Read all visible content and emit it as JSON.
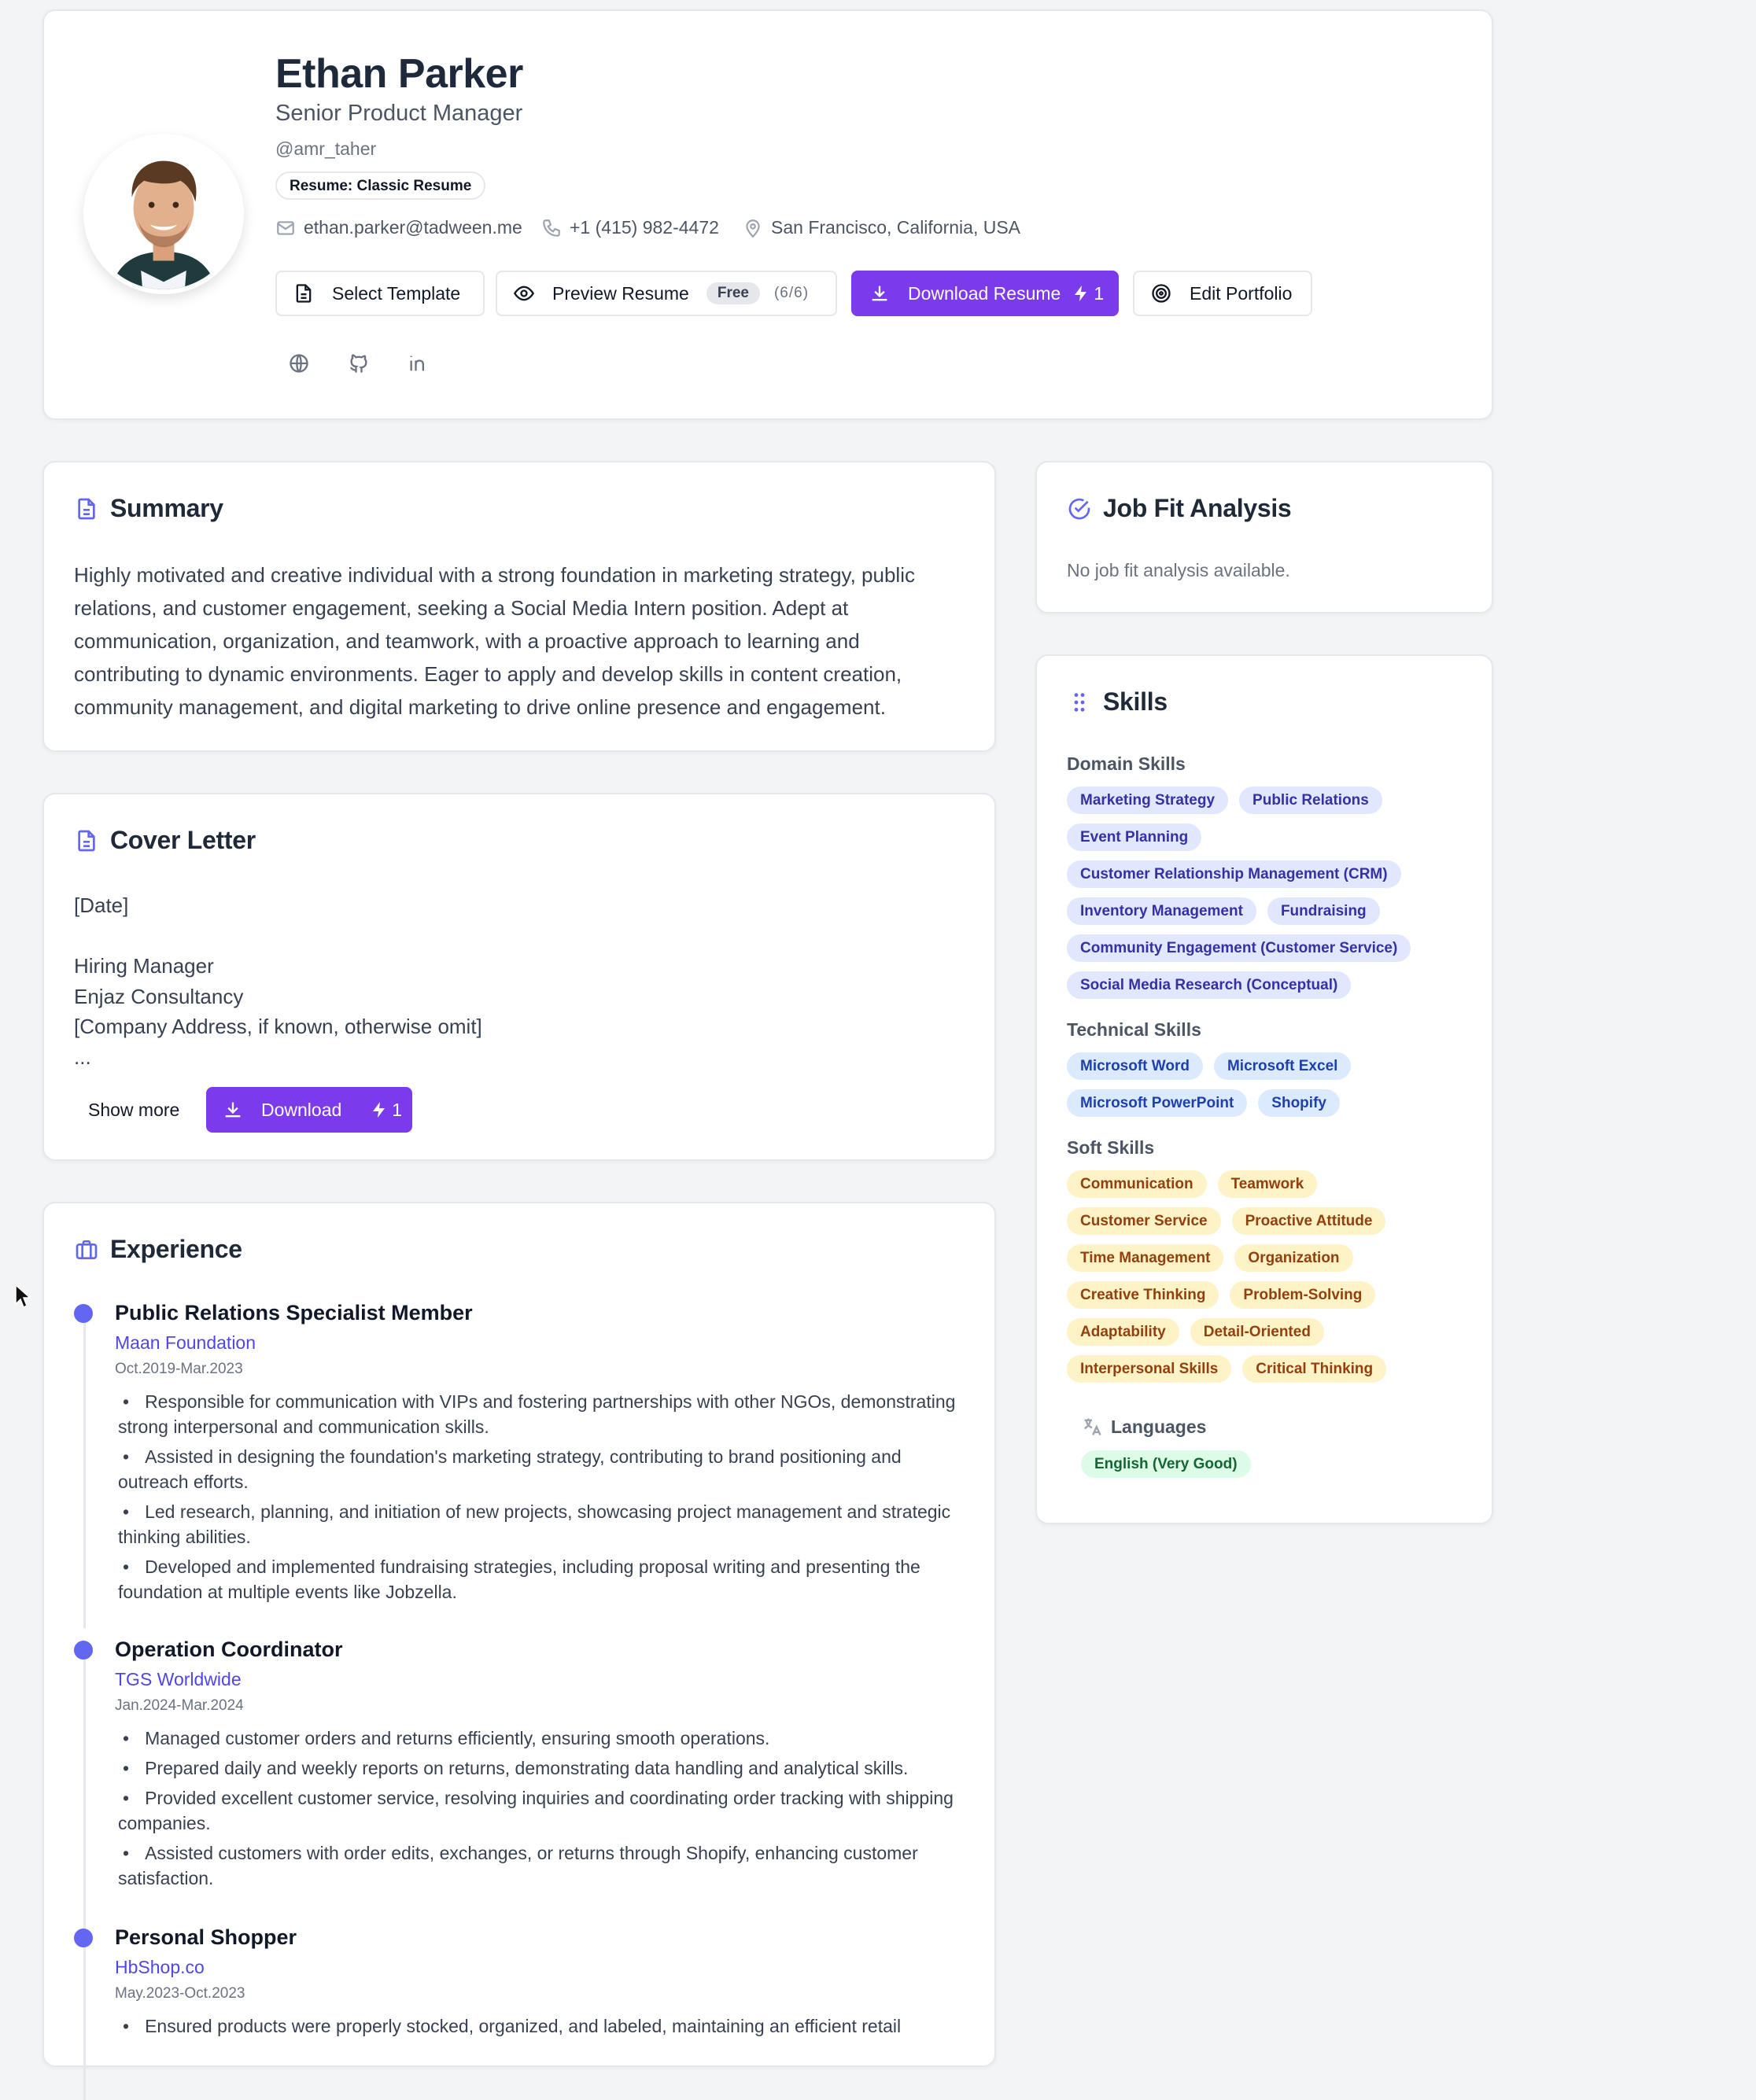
{
  "profile": {
    "name": "Ethan Parker",
    "title": "Senior Product Manager",
    "handle": "@amr_taher",
    "resume_badge": "Resume: Classic Resume",
    "email": "ethan.parker@tadween.me",
    "phone": "+1 (415) 982-4472",
    "location": "San Francisco, California, USA"
  },
  "actions": {
    "select_template": "Select Template",
    "preview_resume": "Preview Resume",
    "preview_free": "Free",
    "preview_count": "(6/6)",
    "download_resume": "Download Resume",
    "download_credits": "1",
    "edit_portfolio": "Edit Portfolio"
  },
  "social_icons": [
    "globe-icon",
    "github-icon",
    "linkedin-icon"
  ],
  "summary": {
    "heading": "Summary",
    "text": "Highly motivated and creative individual with a strong foundation in marketing strategy, public relations, and customer engagement, seeking a Social Media Intern position. Adept at communication, organization, and teamwork, with a proactive approach to learning and contributing to dynamic environments. Eager to apply and develop skills in content creation, community management, and digital marketing to drive online presence and engagement."
  },
  "cover_letter": {
    "heading": "Cover Letter",
    "lines": [
      "[Date]",
      "",
      "Hiring Manager",
      "Enjaz Consultancy",
      "[Company Address, if known, otherwise omit]",
      "..."
    ],
    "show_more": "Show more",
    "download": "Download",
    "download_credits": "1"
  },
  "experience": {
    "heading": "Experience",
    "items": [
      {
        "role": "Public Relations Specialist Member",
        "company": "Maan Foundation",
        "dates": "Oct.2019-Mar.2023",
        "bullets": [
          "Responsible for communication with VIPs and fostering partnerships with other NGOs, demonstrating strong interpersonal and communication skills.",
          "Assisted in designing the foundation's marketing strategy, contributing to brand positioning and outreach efforts.",
          "Led research, planning, and initiation of new projects, showcasing project management and strategic thinking abilities.",
          "Developed and implemented fundraising strategies, including proposal writing and presenting the foundation at multiple events like Jobzella."
        ]
      },
      {
        "role": "Operation Coordinator",
        "company": "TGS Worldwide",
        "dates": "Jan.2024-Mar.2024",
        "bullets": [
          "Managed customer orders and returns efficiently, ensuring smooth operations.",
          "Prepared daily and weekly reports on returns, demonstrating data handling and analytical skills.",
          "Provided excellent customer service, resolving inquiries and coordinating order tracking with shipping companies.",
          "Assisted customers with order edits, exchanges, or returns through Shopify, enhancing customer satisfaction."
        ]
      },
      {
        "role": "Personal Shopper",
        "company": "HbShop.co",
        "dates": "May.2023-Oct.2023",
        "bullets": [
          "Ensured products were properly stocked, organized, and labeled, maintaining an efficient retail"
        ]
      }
    ]
  },
  "job_fit": {
    "heading": "Job Fit Analysis",
    "text": "No job fit analysis available."
  },
  "skills": {
    "heading": "Skills",
    "domain_label": "Domain Skills",
    "domain": [
      "Marketing Strategy",
      "Public Relations",
      "Event Planning",
      "Customer Relationship Management (CRM)",
      "Inventory Management",
      "Fundraising",
      "Community Engagement (Customer Service)",
      "Social Media Research (Conceptual)"
    ],
    "technical_label": "Technical Skills",
    "technical": [
      "Microsoft Word",
      "Microsoft Excel",
      "Microsoft PowerPoint",
      "Shopify"
    ],
    "soft_label": "Soft Skills",
    "soft": [
      "Communication",
      "Teamwork",
      "Customer Service",
      "Proactive Attitude",
      "Time Management",
      "Organization",
      "Creative Thinking",
      "Problem-Solving",
      "Adaptability",
      "Detail-Oriented",
      "Interpersonal Skills",
      "Critical Thinking"
    ],
    "languages_label": "Languages",
    "languages": [
      "English (Very Good)"
    ]
  },
  "colors": {
    "accent": "#7c3aed",
    "indigo": "#6366f1",
    "link": "#4f46e5",
    "background": "#f3f4f6"
  }
}
